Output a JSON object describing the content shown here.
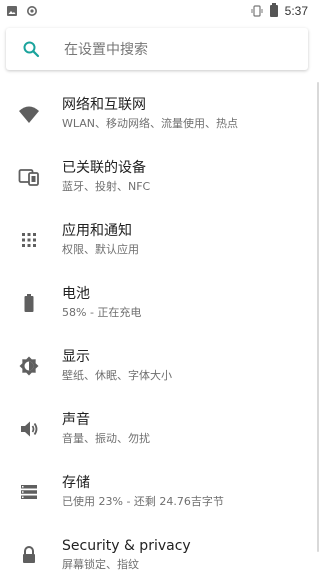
{
  "status_bar": {
    "time": "5:37",
    "left_icons": [
      "image-icon",
      "sync-icon"
    ],
    "right_icons": [
      "vibrate-icon",
      "battery-icon"
    ]
  },
  "search": {
    "placeholder": "在设置中搜索",
    "icon": "search-icon",
    "accent": "#1aa39c"
  },
  "settings": [
    {
      "id": "network",
      "icon": "wifi-icon",
      "title": "网络和互联网",
      "subtitle": "WLAN、移动网络、流量使用、热点"
    },
    {
      "id": "connected",
      "icon": "devices-icon",
      "title": "已关联的设备",
      "subtitle": "蓝牙、投射、NFC"
    },
    {
      "id": "apps",
      "icon": "apps-grid-icon",
      "title": "应用和通知",
      "subtitle": "权限、默认应用"
    },
    {
      "id": "battery",
      "icon": "battery-icon",
      "title": "电池",
      "subtitle": "58% - 正在充电"
    },
    {
      "id": "display",
      "icon": "brightness-icon",
      "title": "显示",
      "subtitle": "壁纸、休眠、字体大小"
    },
    {
      "id": "sound",
      "icon": "volume-icon",
      "title": "声音",
      "subtitle": "音量、振动、勿扰"
    },
    {
      "id": "storage",
      "icon": "storage-icon",
      "title": "存储",
      "subtitle": "已使用 23% - 还剩 24.76吉字节"
    },
    {
      "id": "security",
      "icon": "lock-icon",
      "title": "Security & privacy",
      "subtitle": "屏幕锁定、指纹"
    }
  ],
  "colors": {
    "icon": "#5f5f5f",
    "title": "#222222",
    "subtitle": "#6f6f6f"
  }
}
